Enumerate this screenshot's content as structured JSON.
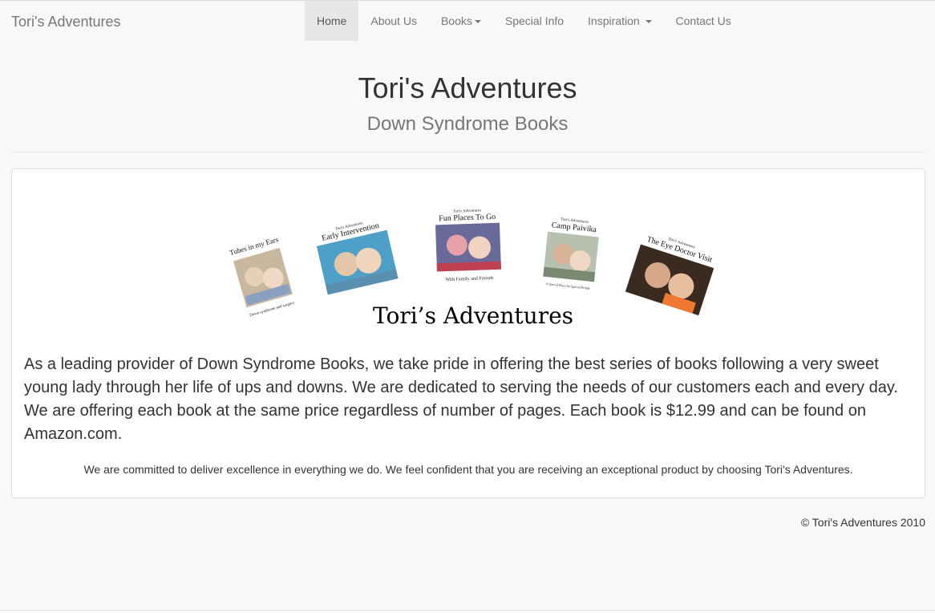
{
  "navbar": {
    "brand": "Tori's Adventures",
    "items": [
      {
        "label": "Home",
        "active": true
      },
      {
        "label": "About Us"
      },
      {
        "label": "Books",
        "dropdown": true
      },
      {
        "label": "Special Info"
      },
      {
        "label": "Inspiration",
        "dropdown": true
      },
      {
        "label": "Contact Us"
      }
    ]
  },
  "header": {
    "title": "Tori's Adventures",
    "subtitle": "Down Syndrome Books"
  },
  "banner": {
    "books": [
      {
        "title": "Tubes in my Ears",
        "caption": "Down syndrome and surgery"
      },
      {
        "title": "Early Intervention",
        "series": "Tori's Adventures"
      },
      {
        "title": "Fun Places To Go",
        "caption": "With Family and Friends",
        "series": "Tori's Adventures"
      },
      {
        "title": "Camp Paivika",
        "caption": "A Special Place for Special People",
        "series": "Tori's Adventures"
      },
      {
        "title": "The Eye Doctor Visit",
        "series": "Tori's Adventures"
      }
    ],
    "logo_text": "Tori’s Adventures"
  },
  "content": {
    "lead": "As a leading provider of Down Syndrome Books, we take pride in offering the best series of books following a very sweet young lady through her life of ups and downs. We are dedicated to serving the needs of our customers each and every day. We are offering each book at the same price regardless of number of pages. Each book is $12.99 and can be found on Amazon.com.",
    "commitment": "We are committed to deliver excellence in everything we do. We feel confident that you are receiving an exceptional product by choosing Tori's Adventures."
  },
  "footer": {
    "copyright": "© Tori's Adventures 2010"
  },
  "colors": {
    "background": "#f8f8f8",
    "nav_active": "#e7e7e7",
    "nav_text": "#777777",
    "text": "#333333"
  }
}
